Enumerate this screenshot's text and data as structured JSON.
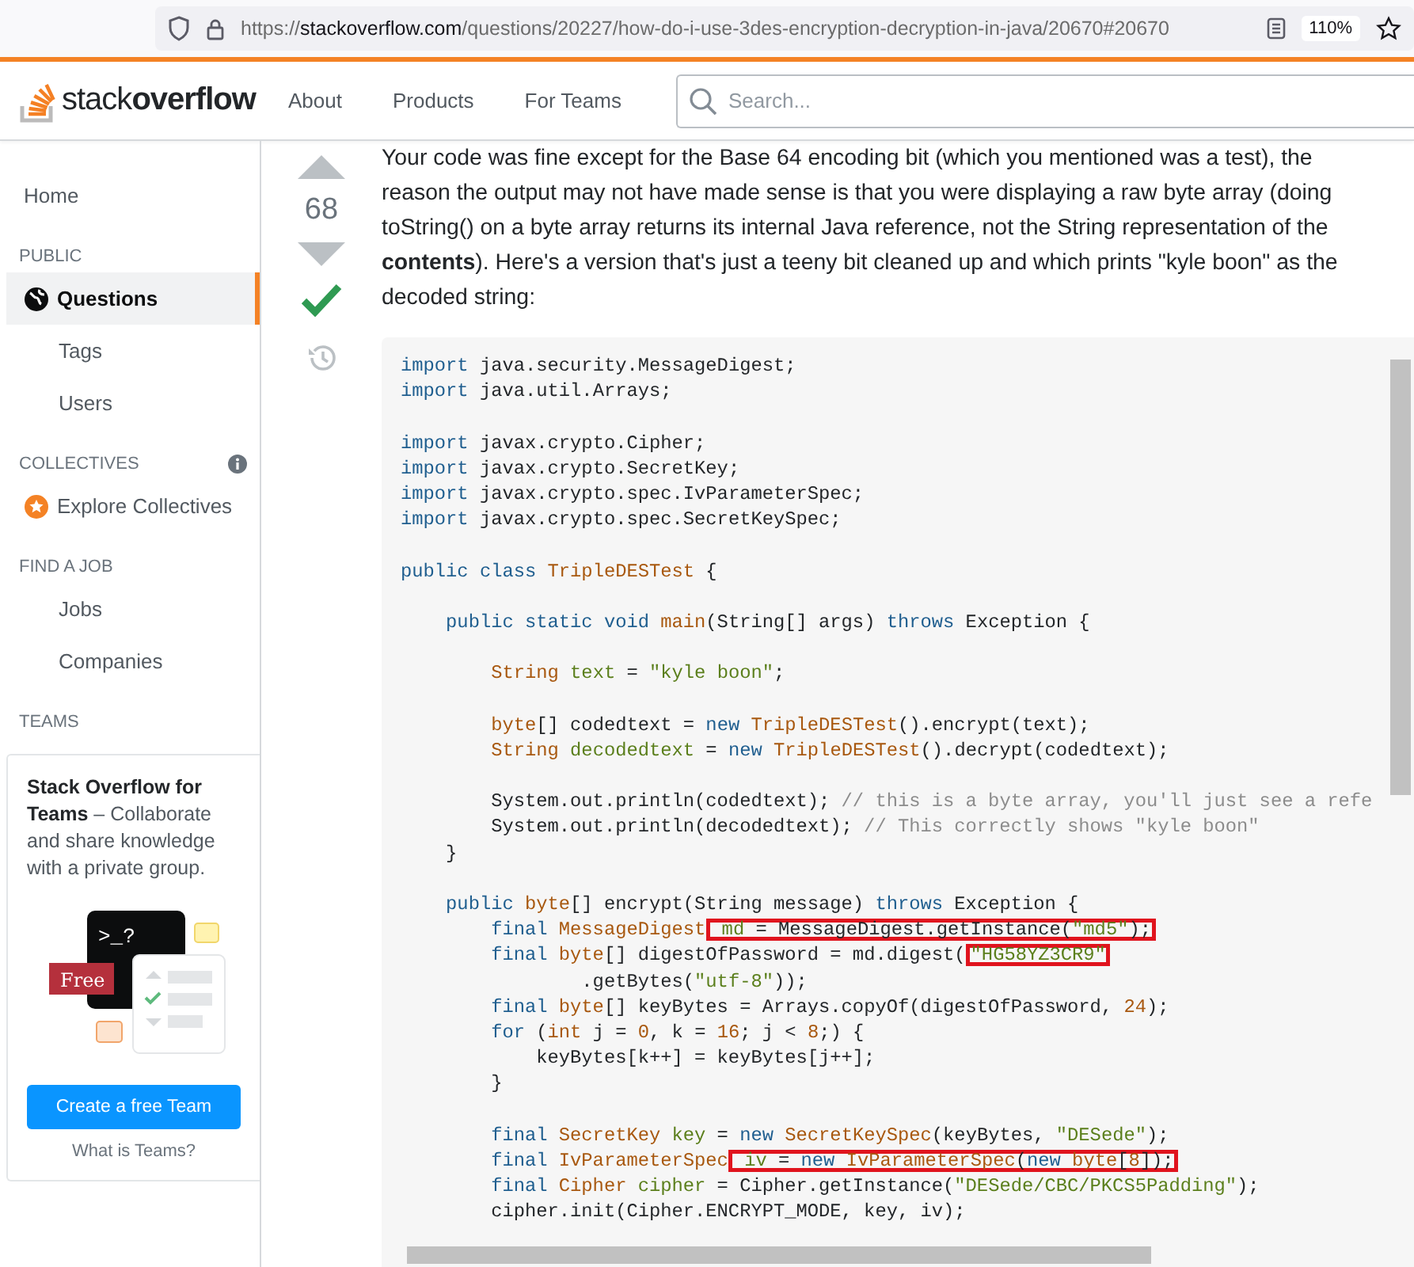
{
  "browser": {
    "url_scheme": "https://",
    "url_domain": "stackoverflow.com",
    "url_path": "/questions/20227/how-do-i-use-3des-encryption-decryption-in-java/20670#20670",
    "zoom": "110%"
  },
  "header": {
    "logo": {
      "light": "stack",
      "bold": "overflow"
    },
    "nav": [
      "About",
      "Products",
      "For Teams"
    ],
    "search": {
      "placeholder": "Search..."
    }
  },
  "sidebar": {
    "items": [
      {
        "kind": "link",
        "label": "Home",
        "selected": false
      },
      {
        "kind": "heading",
        "label": "PUBLIC"
      },
      {
        "kind": "primary",
        "label": "Questions",
        "selected": true
      },
      {
        "kind": "sublink",
        "label": "Tags",
        "selected": false
      },
      {
        "kind": "sublink",
        "label": "Users",
        "selected": false
      },
      {
        "kind": "heading",
        "label": "COLLECTIVES",
        "info": true
      },
      {
        "kind": "collective",
        "label": "Explore Collectives",
        "selected": false
      },
      {
        "kind": "heading",
        "label": "FIND A JOB"
      },
      {
        "kind": "sublink",
        "label": "Jobs",
        "selected": false
      },
      {
        "kind": "sublink",
        "label": "Companies",
        "selected": false
      },
      {
        "kind": "heading",
        "label": "TEAMS"
      }
    ],
    "teams_card": {
      "text": "**Stack Overflow for Teams** – Collaborate and share knowledge with a private group.",
      "illustration": {
        "prompt": ">_?",
        "badge": "Free"
      },
      "button": "Create a free Team",
      "link": "What is Teams?"
    }
  },
  "answer": {
    "score": "68",
    "accepted": true,
    "text": "Your code was fine except for the Base 64 encoding bit (which you mentioned was a test), the reason the output may not have made sense is that you were displaying a raw byte array (doing toString() on a byte array returns its internal Java reference, not the String representation of the **contents**). Here's a version that's just a teeny bit cleaned up and which prints \"kyle boon\" as the decoded string:",
    "code": [
      {
        "kind": "code",
        "tokens": [
          {
            "kind": "keyword",
            "text": "import"
          },
          {
            "kind": "plain",
            "text": " java.security.MessageDigest;"
          }
        ]
      },
      {
        "kind": "code",
        "tokens": [
          {
            "kind": "keyword",
            "text": "import"
          },
          {
            "kind": "plain",
            "text": " java.util.Arrays;"
          }
        ]
      },
      {
        "kind": "blank"
      },
      {
        "kind": "code",
        "tokens": [
          {
            "kind": "keyword",
            "text": "import"
          },
          {
            "kind": "plain",
            "text": " javax.crypto.Cipher;"
          }
        ]
      },
      {
        "kind": "code",
        "tokens": [
          {
            "kind": "keyword",
            "text": "import"
          },
          {
            "kind": "plain",
            "text": " javax.crypto.SecretKey;"
          }
        ]
      },
      {
        "kind": "code",
        "tokens": [
          {
            "kind": "keyword",
            "text": "import"
          },
          {
            "kind": "plain",
            "text": " javax.crypto.spec.IvParameterSpec;"
          }
        ]
      },
      {
        "kind": "code",
        "tokens": [
          {
            "kind": "keyword",
            "text": "import"
          },
          {
            "kind": "plain",
            "text": " javax.crypto.spec.SecretKeySpec;"
          }
        ]
      },
      {
        "kind": "blank"
      },
      {
        "kind": "code",
        "tokens": [
          {
            "kind": "keyword",
            "text": "public class"
          },
          {
            "kind": "type",
            "text": " TripleDESTest"
          },
          {
            "kind": "plain",
            "text": " {"
          }
        ]
      },
      {
        "kind": "blank"
      },
      {
        "kind": "code",
        "tokens": [
          {
            "kind": "keyword",
            "text": "    public static void"
          },
          {
            "kind": "type",
            "text": " main"
          },
          {
            "kind": "plain",
            "text": "(String[] args)"
          },
          {
            "kind": "keyword",
            "text": " throws"
          },
          {
            "kind": "plain",
            "text": " Exception {"
          }
        ]
      },
      {
        "kind": "blank"
      },
      {
        "kind": "code",
        "tokens": [
          {
            "kind": "type",
            "text": "        String"
          },
          {
            "kind": "name",
            "text": " text"
          },
          {
            "kind": "plain",
            "text": " ="
          },
          {
            "kind": "string",
            "text": " \"kyle boon\""
          },
          {
            "kind": "plain",
            "text": ";"
          }
        ]
      },
      {
        "kind": "blank"
      },
      {
        "kind": "code",
        "tokens": [
          {
            "kind": "type",
            "text": "        byte"
          },
          {
            "kind": "plain",
            "text": "[] codedtext ="
          },
          {
            "kind": "keyword",
            "text": " new"
          },
          {
            "kind": "type",
            "text": " TripleDESTest"
          },
          {
            "kind": "plain",
            "text": "().encrypt(text);"
          }
        ]
      },
      {
        "kind": "code",
        "tokens": [
          {
            "kind": "type",
            "text": "        String"
          },
          {
            "kind": "name",
            "text": " decodedtext"
          },
          {
            "kind": "plain",
            "text": " ="
          },
          {
            "kind": "keyword",
            "text": " new"
          },
          {
            "kind": "type",
            "text": " TripleDESTest"
          },
          {
            "kind": "plain",
            "text": "().decrypt(codedtext);"
          }
        ]
      },
      {
        "kind": "blank"
      },
      {
        "kind": "code",
        "tokens": [
          {
            "kind": "plain",
            "text": "        System.out.println(codedtext);"
          },
          {
            "kind": "comment",
            "text": " // this is a byte array, you'll just see a refe"
          }
        ]
      },
      {
        "kind": "code",
        "tokens": [
          {
            "kind": "plain",
            "text": "        System.out.println(decodedtext);"
          },
          {
            "kind": "comment",
            "text": " // This correctly shows \"kyle boon\""
          }
        ]
      },
      {
        "kind": "code",
        "tokens": [
          {
            "kind": "plain",
            "text": "    }"
          }
        ]
      },
      {
        "kind": "blank"
      },
      {
        "kind": "code",
        "tokens": [
          {
            "kind": "keyword",
            "text": "    public"
          },
          {
            "kind": "type",
            "text": " byte"
          },
          {
            "kind": "plain",
            "text": "[] encrypt(String message)"
          },
          {
            "kind": "keyword",
            "text": " throws"
          },
          {
            "kind": "plain",
            "text": " Exception {"
          }
        ]
      },
      {
        "kind": "code",
        "tokens": [
          {
            "kind": "keyword",
            "text": "        final"
          },
          {
            "kind": "type",
            "text": " MessageDigest"
          },
          {
            "kind": "highlight",
            "children": [
              {
                "kind": "name",
                "text": " md"
              },
              {
                "kind": "plain",
                "text": " = MessageDigest.getInstance("
              },
              {
                "kind": "string",
                "text": "\"md5\""
              },
              {
                "kind": "plain",
                "text": ");"
              }
            ]
          }
        ]
      },
      {
        "kind": "code",
        "tokens": [
          {
            "kind": "keyword",
            "text": "        final"
          },
          {
            "kind": "type",
            "text": " byte"
          },
          {
            "kind": "plain",
            "text": "[] digestOfPassword = md.digest("
          },
          {
            "kind": "highlight",
            "children": [
              {
                "kind": "string",
                "text": "\"HG58YZ3CR9\""
              }
            ]
          }
        ]
      },
      {
        "kind": "code",
        "tokens": [
          {
            "kind": "plain",
            "text": "                .getBytes("
          },
          {
            "kind": "string",
            "text": "\"utf-8\""
          },
          {
            "kind": "plain",
            "text": "));"
          }
        ]
      },
      {
        "kind": "code",
        "tokens": [
          {
            "kind": "keyword",
            "text": "        final"
          },
          {
            "kind": "type",
            "text": " byte"
          },
          {
            "kind": "plain",
            "text": "[] keyBytes = Arrays.copyOf(digestOfPassword,"
          },
          {
            "kind": "number",
            "text": " 24"
          },
          {
            "kind": "plain",
            "text": ");"
          }
        ]
      },
      {
        "kind": "code",
        "tokens": [
          {
            "kind": "keyword",
            "text": "        for"
          },
          {
            "kind": "plain",
            "text": " ("
          },
          {
            "kind": "type",
            "text": "int"
          },
          {
            "kind": "plain",
            "text": " j ="
          },
          {
            "kind": "number",
            "text": " 0"
          },
          {
            "kind": "plain",
            "text": ", k ="
          },
          {
            "kind": "number",
            "text": " 16"
          },
          {
            "kind": "plain",
            "text": "; j <"
          },
          {
            "kind": "number",
            "text": " 8"
          },
          {
            "kind": "plain",
            "text": ";) {"
          }
        ]
      },
      {
        "kind": "code",
        "tokens": [
          {
            "kind": "plain",
            "text": "            keyBytes[k++] = keyBytes[j++];"
          }
        ]
      },
      {
        "kind": "code",
        "tokens": [
          {
            "kind": "plain",
            "text": "        }"
          }
        ]
      },
      {
        "kind": "blank"
      },
      {
        "kind": "code",
        "tokens": [
          {
            "kind": "keyword",
            "text": "        final"
          },
          {
            "kind": "type",
            "text": " SecretKey"
          },
          {
            "kind": "name",
            "text": " key"
          },
          {
            "kind": "plain",
            "text": " ="
          },
          {
            "kind": "keyword",
            "text": " new"
          },
          {
            "kind": "type",
            "text": " SecretKeySpec"
          },
          {
            "kind": "plain",
            "text": "(keyBytes,"
          },
          {
            "kind": "string",
            "text": " \"DESede\""
          },
          {
            "kind": "plain",
            "text": ");"
          }
        ]
      },
      {
        "kind": "code",
        "tokens": [
          {
            "kind": "keyword",
            "text": "        final"
          },
          {
            "kind": "type",
            "text": " IvParameterSpec"
          },
          {
            "kind": "highlight",
            "children": [
              {
                "kind": "name",
                "text": " iv"
              },
              {
                "kind": "plain",
                "text": " ="
              },
              {
                "kind": "keyword",
                "text": " new"
              },
              {
                "kind": "type",
                "text": " IvParameterSpec"
              },
              {
                "kind": "plain",
                "text": "("
              },
              {
                "kind": "keyword",
                "text": "new"
              },
              {
                "kind": "type",
                "text": " byte"
              },
              {
                "kind": "plain",
                "text": "["
              },
              {
                "kind": "number",
                "text": "8"
              },
              {
                "kind": "plain",
                "text": "]);"
              }
            ]
          }
        ]
      },
      {
        "kind": "code",
        "tokens": [
          {
            "kind": "keyword",
            "text": "        final"
          },
          {
            "kind": "type",
            "text": " Cipher"
          },
          {
            "kind": "name",
            "text": " cipher"
          },
          {
            "kind": "plain",
            "text": " = Cipher.getInstance("
          },
          {
            "kind": "string",
            "text": "\"DESede/CBC/PKCS5Padding\""
          },
          {
            "kind": "plain",
            "text": ");"
          }
        ]
      },
      {
        "kind": "code",
        "tokens": [
          {
            "kind": "plain",
            "text": "        cipher.init(Cipher.ENCRYPT_MODE, key, iv);"
          }
        ]
      }
    ]
  }
}
